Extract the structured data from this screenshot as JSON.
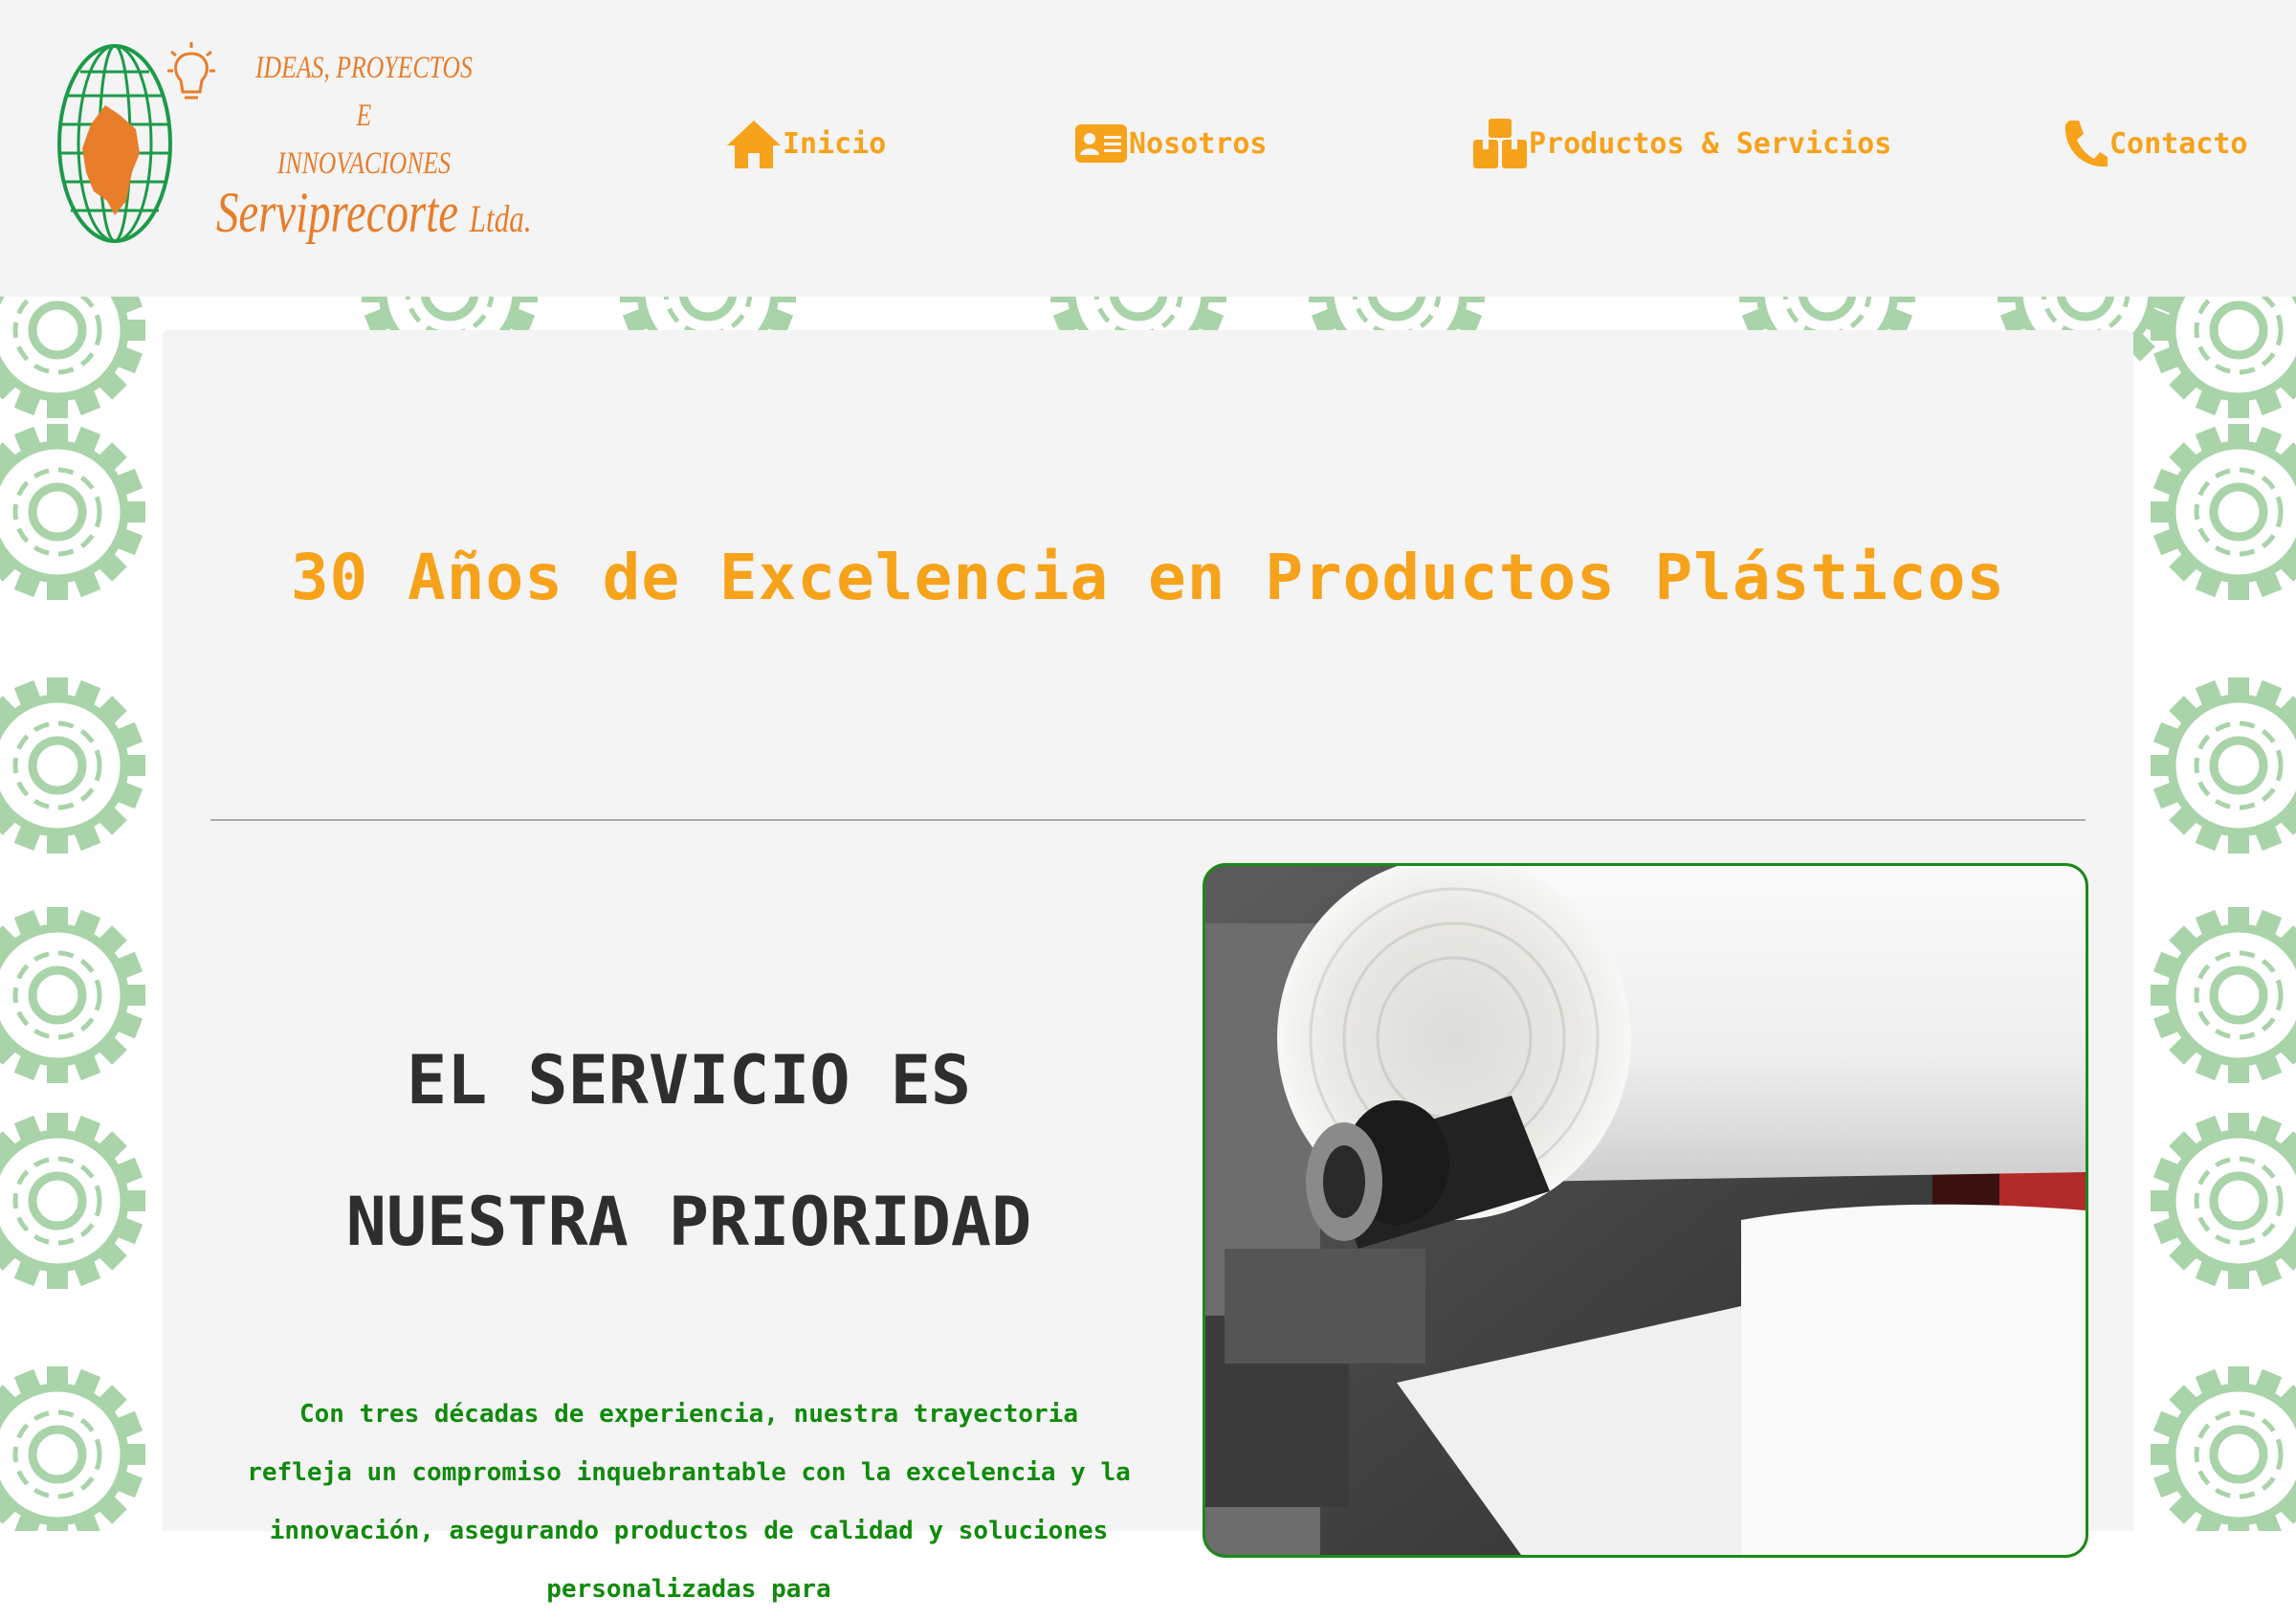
{
  "brand": {
    "tagline_lines": [
      "IDEAS, PROYECTOS",
      "E",
      "INNOVACIONES"
    ],
    "company_name": "Serviprecorte",
    "company_suffix": "Ltda."
  },
  "nav": {
    "items": [
      {
        "label": "Inicio",
        "icon": "home-icon"
      },
      {
        "label": "Nosotros",
        "icon": "id-card-icon"
      },
      {
        "label": "Productos & Servicios",
        "icon": "boxes-icon"
      },
      {
        "label": "Contacto",
        "icon": "phone-icon"
      }
    ]
  },
  "hero": {
    "title": "30 Años de Excelencia en Productos Plásticos"
  },
  "service": {
    "heading_lines": [
      "EL SERVICIO ES",
      "NUESTRA PRIORIDAD"
    ],
    "body": "Con tres décadas de experiencia, nuestra trayectoria refleja un compromiso inquebrantable con la excelencia y la innovación, asegurando productos de calidad y soluciones personalizadas para"
  },
  "colors": {
    "accent_orange": "#f7a21b",
    "logo_orange": "#e87d2a",
    "green": "#118a0d",
    "gear_green": "#a9d3a9",
    "panel": "#f4f4f4"
  }
}
